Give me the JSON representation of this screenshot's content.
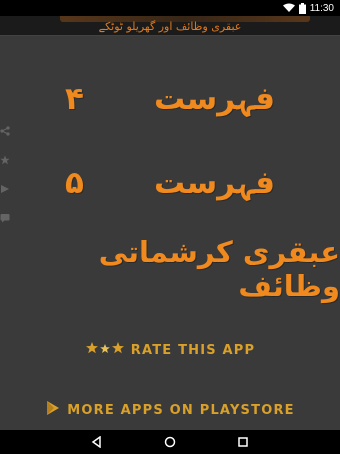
{
  "status_bar": {
    "time": "11:30",
    "wifi_icon": "wifi-icon",
    "battery_icon": "battery-icon"
  },
  "header": {
    "title": "عبقری وظائف اور گھریلو ٹوٹکے"
  },
  "menu": {
    "items": [
      {
        "label": "فہرست",
        "number": "۴"
      },
      {
        "label": "فہرست",
        "number": "۵"
      },
      {
        "label": "عبقری کرشماتی وظائف",
        "number": ""
      }
    ]
  },
  "actions": {
    "rate_label": "RATE THIS APP",
    "more_label": "MORE APPS ON PLAYSTORE"
  },
  "side_icons": [
    "share-icon",
    "star-icon",
    "play-icon",
    "message-icon"
  ],
  "colors": {
    "background": "#3a3a3a",
    "menu_text": "#f08a1e",
    "action_text": "#d9a02a",
    "bar": "#000000"
  }
}
